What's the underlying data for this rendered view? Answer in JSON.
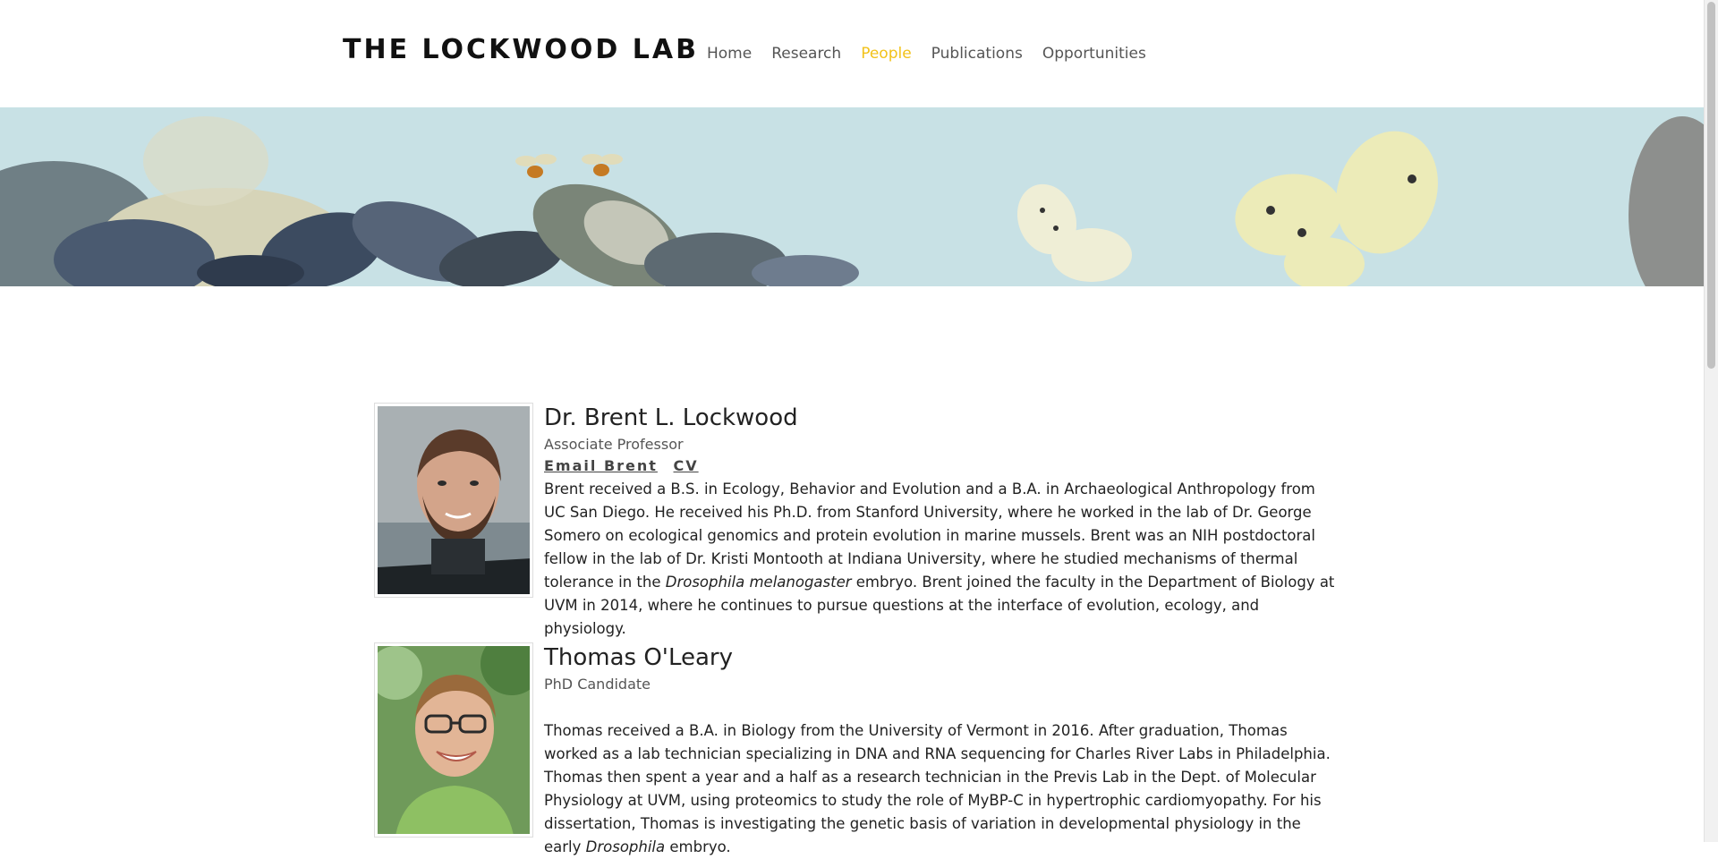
{
  "header": {
    "logo": "THE LOCKWOOD LAB",
    "nav": [
      "Home",
      "Research",
      "People",
      "Publications",
      "Opportunities"
    ],
    "active_nav": "People",
    "accent_color": "#f2c21a"
  },
  "people": [
    {
      "name": "Dr. Brent L. Lockwood",
      "title": "Associate Professor",
      "email_label": "Email Brent",
      "cv_label": "CV",
      "bio_part1": "Brent received a B.S. in Ecology, Behavior and Evolution and a B.A. in Archaeological Anthropology from UC San Diego. He received his Ph.D. from Stanford University, where he worked in the lab of Dr. George Somero on ecological genomics and protein evolution in marine mussels. Brent was an NIH postdoctoral fellow in the lab of Dr. Kristi Montooth at Indiana University, where he studied mechanisms of thermal tolerance in the ",
      "bio_italic": "Drosophila melanogaster",
      "bio_part2": " embryo. Brent joined the faculty in the Department of Biology at UVM in 2014, where he continues to pursue questions at the interface of evolution, ecology, and physiology."
    },
    {
      "name": "Thomas O'Leary",
      "title": "PhD Candidate",
      "bio_part1": "Thomas received a B.A. in Biology from the University of Vermont in 2016. After graduation, Thomas worked as a lab technician specializing in DNA and RNA sequencing for Charles River Labs in Philadelphia. Thomas then spent a year and a half as a research technician in the Previs Lab in the Dept. of Molecular Physiology at UVM, using proteomics to study the role of MyBP-C in hypertrophic cardiomyopathy. For his dissertation, Thomas is investigating the genetic basis of variation in developmental physiology in the early ",
      "bio_italic": "Drosophila",
      "bio_part2": " embryo."
    }
  ]
}
